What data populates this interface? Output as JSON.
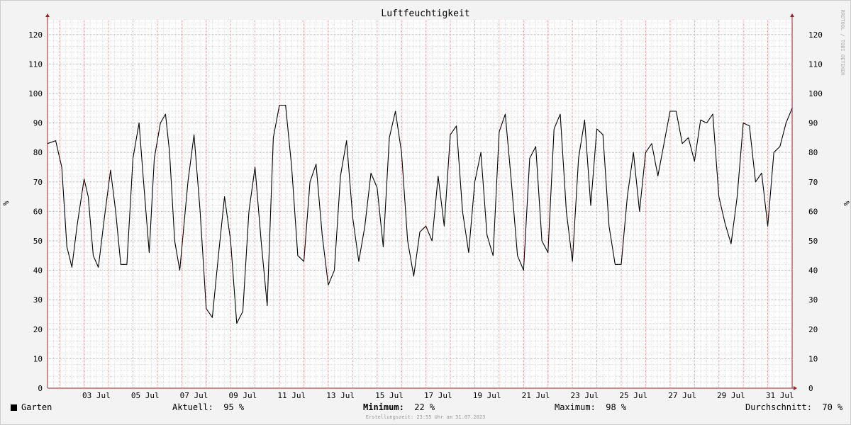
{
  "chart_data": {
    "type": "line",
    "title": "Luftfeuchtigkeit",
    "ylabel": "%",
    "ylim": [
      0,
      125
    ],
    "yticks": [
      0,
      10,
      20,
      30,
      40,
      50,
      60,
      70,
      80,
      90,
      100,
      110,
      120
    ],
    "xlim": [
      "2023-07-01T12:00",
      "2023-07-31T24:00"
    ],
    "xtick_labels": [
      "03 Jul",
      "05 Jul",
      "07 Jul",
      "09 Jul",
      "11 Jul",
      "13 Jul",
      "15 Jul",
      "17 Jul",
      "19 Jul",
      "21 Jul",
      "23 Jul",
      "25 Jul",
      "27 Jul",
      "29 Jul",
      "31 Jul"
    ],
    "xtick_dates": [
      "2023-07-03T12:00",
      "2023-07-05T12:00",
      "2023-07-07T12:00",
      "2023-07-09T12:00",
      "2023-07-11T12:00",
      "2023-07-13T12:00",
      "2023-07-15T12:00",
      "2023-07-17T12:00",
      "2023-07-19T12:00",
      "2023-07-21T12:00",
      "2023-07-23T12:00",
      "2023-07-25T12:00",
      "2023-07-27T12:00",
      "2023-07-29T12:00",
      "2023-07-31T12:00"
    ],
    "grid": true,
    "series": [
      {
        "name": "Garten",
        "color": "#000000",
        "points": [
          [
            "2023-07-01T12:00",
            83
          ],
          [
            "2023-07-01T20:00",
            84
          ],
          [
            "2023-07-02T02:00",
            75
          ],
          [
            "2023-07-02T07:00",
            48
          ],
          [
            "2023-07-02T12:00",
            41
          ],
          [
            "2023-07-02T17:00",
            55
          ],
          [
            "2023-07-03T00:00",
            71
          ],
          [
            "2023-07-03T04:00",
            65
          ],
          [
            "2023-07-03T09:00",
            45
          ],
          [
            "2023-07-03T14:00",
            41
          ],
          [
            "2023-07-03T20:00",
            58
          ],
          [
            "2023-07-04T02:00",
            74
          ],
          [
            "2023-07-04T07:00",
            60
          ],
          [
            "2023-07-04T12:00",
            42
          ],
          [
            "2023-07-04T18:00",
            42
          ],
          [
            "2023-07-05T00:00",
            78
          ],
          [
            "2023-07-05T06:00",
            90
          ],
          [
            "2023-07-05T10:00",
            72
          ],
          [
            "2023-07-05T16:00",
            46
          ],
          [
            "2023-07-05T21:00",
            78
          ],
          [
            "2023-07-06T03:00",
            90
          ],
          [
            "2023-07-06T08:00",
            93
          ],
          [
            "2023-07-06T12:00",
            80
          ],
          [
            "2023-07-06T17:00",
            50
          ],
          [
            "2023-07-06T22:00",
            40
          ],
          [
            "2023-07-07T06:00",
            70
          ],
          [
            "2023-07-07T12:00",
            86
          ],
          [
            "2023-07-07T18:00",
            60
          ],
          [
            "2023-07-08T00:00",
            27
          ],
          [
            "2023-07-08T06:00",
            24
          ],
          [
            "2023-07-08T12:00",
            45
          ],
          [
            "2023-07-08T18:00",
            65
          ],
          [
            "2023-07-09T00:00",
            50
          ],
          [
            "2023-07-09T06:00",
            22
          ],
          [
            "2023-07-09T12:00",
            26
          ],
          [
            "2023-07-09T18:00",
            60
          ],
          [
            "2023-07-10T00:00",
            75
          ],
          [
            "2023-07-10T06:00",
            50
          ],
          [
            "2023-07-10T12:00",
            28
          ],
          [
            "2023-07-10T18:00",
            85
          ],
          [
            "2023-07-11T00:00",
            96
          ],
          [
            "2023-07-11T06:00",
            96
          ],
          [
            "2023-07-11T12:00",
            75
          ],
          [
            "2023-07-11T18:00",
            45
          ],
          [
            "2023-07-12T00:00",
            43
          ],
          [
            "2023-07-12T06:00",
            70
          ],
          [
            "2023-07-12T12:00",
            76
          ],
          [
            "2023-07-12T18:00",
            52
          ],
          [
            "2023-07-13T00:00",
            35
          ],
          [
            "2023-07-13T06:00",
            40
          ],
          [
            "2023-07-13T12:00",
            72
          ],
          [
            "2023-07-13T18:00",
            84
          ],
          [
            "2023-07-14T00:00",
            58
          ],
          [
            "2023-07-14T06:00",
            43
          ],
          [
            "2023-07-14T12:00",
            55
          ],
          [
            "2023-07-14T18:00",
            73
          ],
          [
            "2023-07-15T00:00",
            68
          ],
          [
            "2023-07-15T06:00",
            48
          ],
          [
            "2023-07-15T12:00",
            85
          ],
          [
            "2023-07-15T18:00",
            94
          ],
          [
            "2023-07-16T00:00",
            80
          ],
          [
            "2023-07-16T06:00",
            50
          ],
          [
            "2023-07-16T12:00",
            38
          ],
          [
            "2023-07-16T18:00",
            53
          ],
          [
            "2023-07-17T00:00",
            55
          ],
          [
            "2023-07-17T06:00",
            50
          ],
          [
            "2023-07-17T12:00",
            72
          ],
          [
            "2023-07-17T18:00",
            55
          ],
          [
            "2023-07-18T00:00",
            86
          ],
          [
            "2023-07-18T06:00",
            89
          ],
          [
            "2023-07-18T12:00",
            60
          ],
          [
            "2023-07-18T18:00",
            46
          ],
          [
            "2023-07-19T00:00",
            70
          ],
          [
            "2023-07-19T06:00",
            80
          ],
          [
            "2023-07-19T12:00",
            52
          ],
          [
            "2023-07-19T18:00",
            45
          ],
          [
            "2023-07-20T00:00",
            87
          ],
          [
            "2023-07-20T06:00",
            93
          ],
          [
            "2023-07-20T12:00",
            70
          ],
          [
            "2023-07-20T18:00",
            45
          ],
          [
            "2023-07-21T00:00",
            40
          ],
          [
            "2023-07-21T06:00",
            78
          ],
          [
            "2023-07-21T12:00",
            82
          ],
          [
            "2023-07-21T18:00",
            50
          ],
          [
            "2023-07-22T00:00",
            46
          ],
          [
            "2023-07-22T06:00",
            88
          ],
          [
            "2023-07-22T12:00",
            93
          ],
          [
            "2023-07-22T18:00",
            60
          ],
          [
            "2023-07-23T00:00",
            43
          ],
          [
            "2023-07-23T06:00",
            78
          ],
          [
            "2023-07-23T12:00",
            91
          ],
          [
            "2023-07-23T18:00",
            62
          ],
          [
            "2023-07-24T00:00",
            88
          ],
          [
            "2023-07-24T06:00",
            86
          ],
          [
            "2023-07-24T12:00",
            55
          ],
          [
            "2023-07-24T18:00",
            42
          ],
          [
            "2023-07-25T00:00",
            42
          ],
          [
            "2023-07-25T06:00",
            65
          ],
          [
            "2023-07-25T12:00",
            80
          ],
          [
            "2023-07-25T18:00",
            60
          ],
          [
            "2023-07-26T00:00",
            80
          ],
          [
            "2023-07-26T06:00",
            83
          ],
          [
            "2023-07-26T12:00",
            72
          ],
          [
            "2023-07-26T18:00",
            83
          ],
          [
            "2023-07-27T00:00",
            94
          ],
          [
            "2023-07-27T06:00",
            94
          ],
          [
            "2023-07-27T12:00",
            83
          ],
          [
            "2023-07-27T18:00",
            85
          ],
          [
            "2023-07-28T00:00",
            77
          ],
          [
            "2023-07-28T06:00",
            91
          ],
          [
            "2023-07-28T12:00",
            90
          ],
          [
            "2023-07-28T18:00",
            93
          ],
          [
            "2023-07-29T00:00",
            65
          ],
          [
            "2023-07-29T06:00",
            56
          ],
          [
            "2023-07-29T12:00",
            49
          ],
          [
            "2023-07-29T18:00",
            65
          ],
          [
            "2023-07-30T00:00",
            90
          ],
          [
            "2023-07-30T06:00",
            89
          ],
          [
            "2023-07-30T12:00",
            70
          ],
          [
            "2023-07-30T18:00",
            73
          ],
          [
            "2023-07-31T00:00",
            55
          ],
          [
            "2023-07-31T06:00",
            80
          ],
          [
            "2023-07-31T12:00",
            82
          ],
          [
            "2023-07-31T18:00",
            90
          ],
          [
            "2023-07-31T24:00",
            95
          ]
        ]
      }
    ]
  },
  "watermark": "RRDTOOL / TOBI OETIKER",
  "legend": {
    "series_name": "Garten",
    "aktuell_label": "Aktuell:",
    "aktuell_value": "95 %",
    "minimum_label": "Minimum:",
    "minimum_value": "22 %",
    "maximum_label": "Maximum:",
    "maximum_value": "98 %",
    "durchschnitt_label": "Durchschnitt:",
    "durchschnitt_value": "70 %"
  },
  "footer": "Erstellungszeit: 23:55 Uhr am 31.07.2023",
  "colors": {
    "background": "#f3f3f3",
    "plot": "#ffffff",
    "minor_grid": "#dddddd",
    "major_grid": "#e8a0a0",
    "line": "#000000",
    "arrow": "#a02020"
  }
}
